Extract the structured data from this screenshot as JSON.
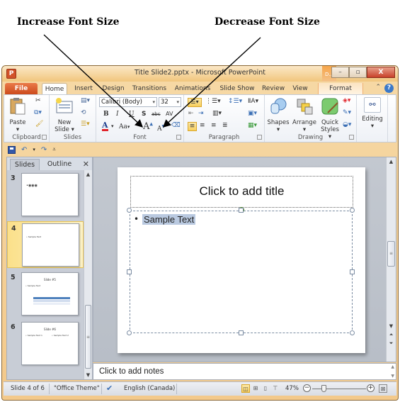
{
  "annotations": {
    "increase": "Increase Font Size",
    "decrease": "Decrease Font Size"
  },
  "window": {
    "app_icon": "P",
    "title": "Title Slide2.pptx  -  Microsoft PowerPoint",
    "context_tab_short": "D...",
    "minimize": "–",
    "restore": "▫",
    "close": "X"
  },
  "tabs": [
    {
      "label": "File"
    },
    {
      "label": "Home"
    },
    {
      "label": "Insert"
    },
    {
      "label": "Design"
    },
    {
      "label": "Transitions"
    },
    {
      "label": "Animations"
    },
    {
      "label": "Slide Show"
    },
    {
      "label": "Review"
    },
    {
      "label": "View"
    },
    {
      "label": "Format"
    }
  ],
  "help": "?",
  "ribbon": {
    "clipboard": {
      "label": "Clipboard",
      "paste": "Paste",
      "paste_dd": "▾"
    },
    "slides": {
      "label": "Slides",
      "new_slide_1": "New",
      "new_slide_2": "Slide ▾"
    },
    "font": {
      "label": "Font",
      "font_name": "Calibri (Body)",
      "font_size": "32",
      "bold": "B",
      "italic": "I",
      "underline": "U",
      "shadow": "S",
      "strike": "abc",
      "spacing": "AV",
      "font_color": "A",
      "change_case": "Aa",
      "grow": "A",
      "shrink": "A"
    },
    "paragraph": {
      "label": "Paragraph"
    },
    "drawing": {
      "label": "Drawing",
      "shapes": "Shapes",
      "arrange": "Arrange",
      "quick_1": "Quick",
      "quick_2": "Styles ▾"
    },
    "editing": {
      "label": "Editing"
    }
  },
  "left_pane": {
    "tabs": [
      "Slides",
      "Outline"
    ],
    "close": "✕",
    "thumbnails": [
      {
        "num": "3",
        "title": "",
        "body": [
          "•◉◉◉"
        ]
      },
      {
        "num": "4",
        "title": "",
        "body": [
          "• Sample Text"
        ]
      },
      {
        "num": "5",
        "title": "Slide #5",
        "body": [
          "• Sample Text"
        ],
        "has_table": true
      },
      {
        "num": "6",
        "title": "Slide #6",
        "body": [
          "• Sample Text 1",
          "• Sample Text 2"
        ]
      }
    ],
    "selected_index": 1
  },
  "slide": {
    "title_placeholder": "Click to add title",
    "bullet": "•",
    "body_text": "Sample Text"
  },
  "notes": {
    "placeholder": "Click to add notes"
  },
  "statusbar": {
    "slide_info": "Slide 4 of 6",
    "theme": "\"Office Theme\"",
    "language": "English (Canada)",
    "zoom_percent": "47%",
    "zoom_level": 0.47,
    "zoom_minus": "−",
    "zoom_plus": "+"
  }
}
